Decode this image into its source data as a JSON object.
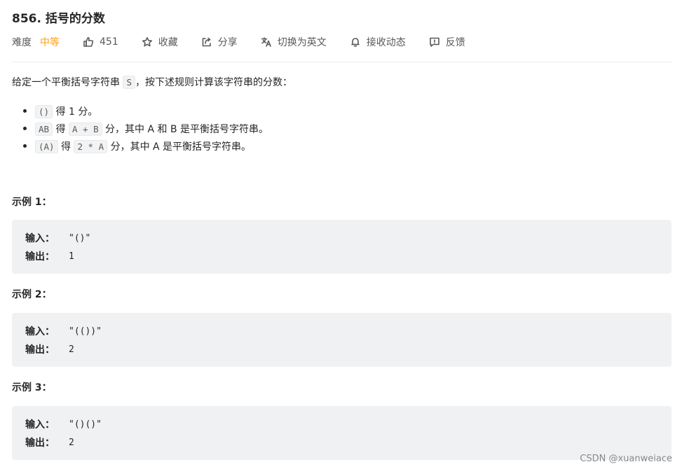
{
  "problem": {
    "title": "856. 括号的分数"
  },
  "meta": {
    "difficulty_label": "难度",
    "difficulty_value": "中等",
    "likes": "451",
    "favorite": "收藏",
    "share": "分享",
    "switch_lang": "切换为英文",
    "subscribe": "接收动态",
    "feedback": "反馈",
    "difficulty_color": "#ffa116"
  },
  "description": {
    "intro_prefix": "给定一个平衡括号字符串 ",
    "intro_code": "S",
    "intro_suffix": "，按下述规则计算该字符串的分数：",
    "rules": [
      {
        "code1": "()",
        "text1": " 得 1 分。",
        "code2": "",
        "text2": ""
      },
      {
        "code1": "AB",
        "text1": " 得 ",
        "code2": "A + B",
        "text2": " 分，其中 A 和 B 是平衡括号字符串。"
      },
      {
        "code1": "(A)",
        "text1": " 得 ",
        "code2": "2 * A",
        "text2": " 分，其中 A 是平衡括号字符串。"
      }
    ]
  },
  "examples": [
    {
      "heading": "示例 1：",
      "input_label": "输入：",
      "input": "\"()\"",
      "output_label": "输出：",
      "output": "1"
    },
    {
      "heading": "示例 2：",
      "input_label": "输入：",
      "input": "\"(())\"",
      "output_label": "输出：",
      "output": "2"
    },
    {
      "heading": "示例 3：",
      "input_label": "输入：",
      "input": "\"()()\"",
      "output_label": "输出：",
      "output": "2"
    }
  ],
  "watermark": "CSDN @xuanweiace"
}
